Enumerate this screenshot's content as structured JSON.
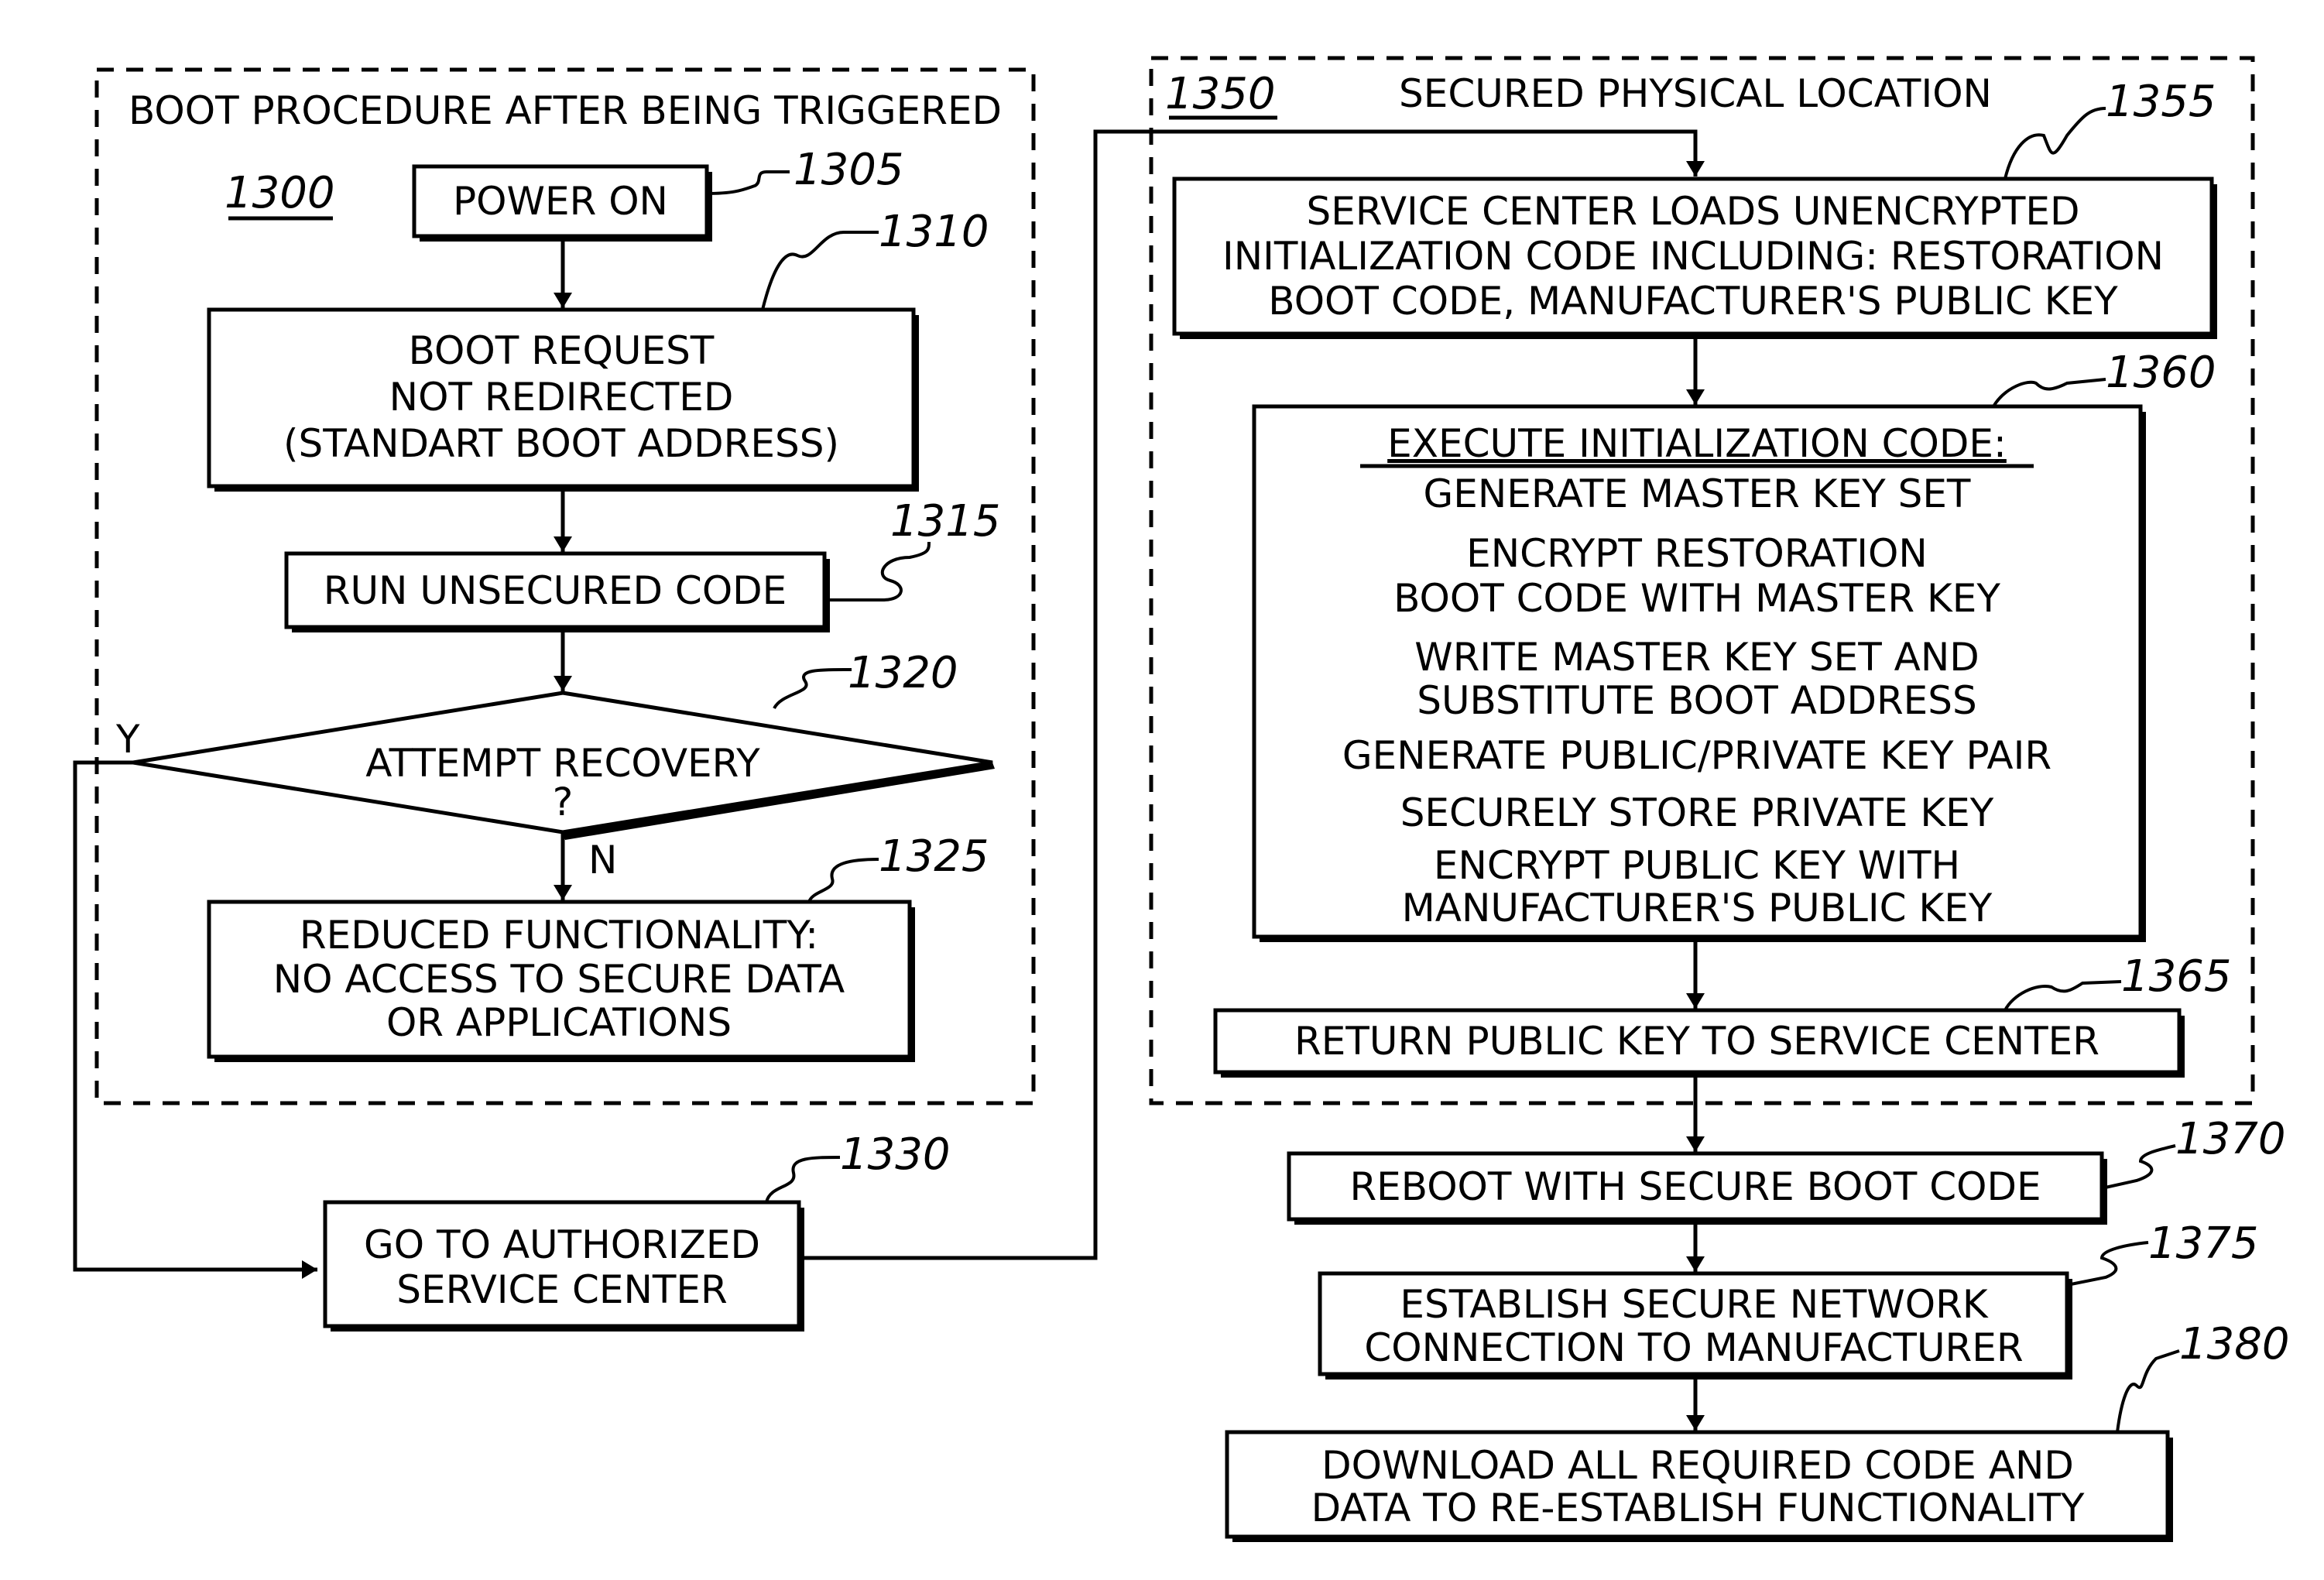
{
  "figure": {
    "left_group": {
      "ref": "1300",
      "title": "BOOT PROCEDURE AFTER BEING TRIGGERED"
    },
    "right_group": {
      "ref": "1350",
      "title": "SECURED PHYSICAL LOCATION"
    },
    "steps": [
      {
        "id": "1305",
        "lines": [
          "POWER ON"
        ]
      },
      {
        "id": "1310",
        "lines": [
          "BOOT REQUEST",
          "NOT REDIRECTED",
          "(STANDART BOOT ADDRESS)"
        ]
      },
      {
        "id": "1315",
        "lines": [
          "RUN UNSECURED CODE"
        ]
      },
      {
        "id": "1320",
        "lines": [
          "ATTEMPT RECOVERY",
          "?"
        ],
        "type": "decision",
        "yes_label": "Y",
        "no_label": "N"
      },
      {
        "id": "1325",
        "lines": [
          "REDUCED FUNCTIONALITY:",
          "NO ACCESS TO SECURE DATA",
          "OR APPLICATIONS"
        ]
      },
      {
        "id": "1330",
        "lines": [
          "GO TO AUTHORIZED",
          "SERVICE CENTER"
        ]
      },
      {
        "id": "1355",
        "lines": [
          "SERVICE CENTER LOADS UNENCRYPTED",
          "INITIALIZATION CODE INCLUDING: RESTORATION",
          "BOOT CODE, MANUFACTURER'S PUBLIC KEY"
        ]
      },
      {
        "id": "1360",
        "heading": "EXECUTE INITIALIZATION CODE:",
        "lines": [
          "GENERATE  MASTER KEY SET",
          "ENCRYPT RESTORATION",
          "BOOT CODE WITH MASTER KEY",
          "WRITE MASTER KEY SET AND",
          "SUBSTITUTE BOOT ADDRESS",
          "GENERATE PUBLIC/PRIVATE KEY PAIR",
          "SECURELY STORE PRIVATE KEY",
          "ENCRYPT PUBLIC KEY WITH",
          "MANUFACTURER'S PUBLIC KEY"
        ]
      },
      {
        "id": "1365",
        "lines": [
          "RETURN PUBLIC KEY TO SERVICE CENTER"
        ]
      },
      {
        "id": "1370",
        "lines": [
          "REBOOT WITH SECURE BOOT CODE"
        ]
      },
      {
        "id": "1375",
        "lines": [
          "ESTABLISH SECURE NETWORK",
          "CONNECTION TO MANUFACTURER"
        ]
      },
      {
        "id": "1380",
        "lines": [
          "DOWNLOAD ALL REQUIRED CODE AND",
          "DATA TO RE-ESTABLISH FUNCTIONALITY"
        ]
      }
    ]
  }
}
